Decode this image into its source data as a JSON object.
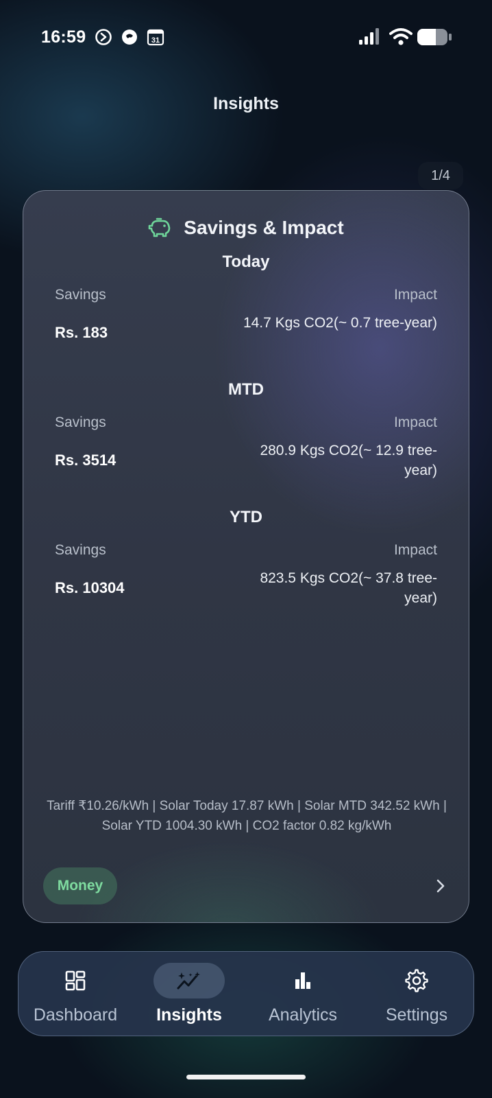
{
  "status_bar": {
    "time": "16:59",
    "calendar_day": "31",
    "icons": [
      "arrow-badge-icon",
      "chat-bubble-icon",
      "calendar-icon",
      "signal-icon",
      "wifi-icon",
      "battery-icon"
    ]
  },
  "header": {
    "title": "Insights"
  },
  "pager": {
    "label": "1/4"
  },
  "card": {
    "icon": "piggy-bank-icon",
    "title": "Savings & Impact",
    "sections": [
      {
        "title": "Today",
        "savings_label": "Savings",
        "impact_label": "Impact",
        "savings_value": "Rs. 183",
        "impact_value": "14.7 Kgs CO2(~ 0.7 tree-year)"
      },
      {
        "title": "MTD",
        "savings_label": "Savings",
        "impact_label": "Impact",
        "savings_value": "Rs. 3514",
        "impact_value": "280.9 Kgs CO2(~ 12.9 tree-year)"
      },
      {
        "title": "YTD",
        "savings_label": "Savings",
        "impact_label": "Impact",
        "savings_value": "Rs. 10304",
        "impact_value": "823.5 Kgs CO2(~ 37.8 tree-year)"
      }
    ],
    "footnote": "Tariff ₹10.26/kWh | Solar Today 17.87 kWh | Solar MTD 342.52 kWh | Solar YTD 1004.30 kWh | CO2 factor 0.82 kg/kWh",
    "chip_label": "Money",
    "accent_color": "#6fd69a"
  },
  "bottom_nav": {
    "items": [
      {
        "label": "Dashboard",
        "icon": "dashboard-grid-icon",
        "active": false
      },
      {
        "label": "Insights",
        "icon": "sparkle-trend-icon",
        "active": true
      },
      {
        "label": "Analytics",
        "icon": "bar-chart-icon",
        "active": false
      },
      {
        "label": "Settings",
        "icon": "gear-icon",
        "active": false
      }
    ]
  }
}
